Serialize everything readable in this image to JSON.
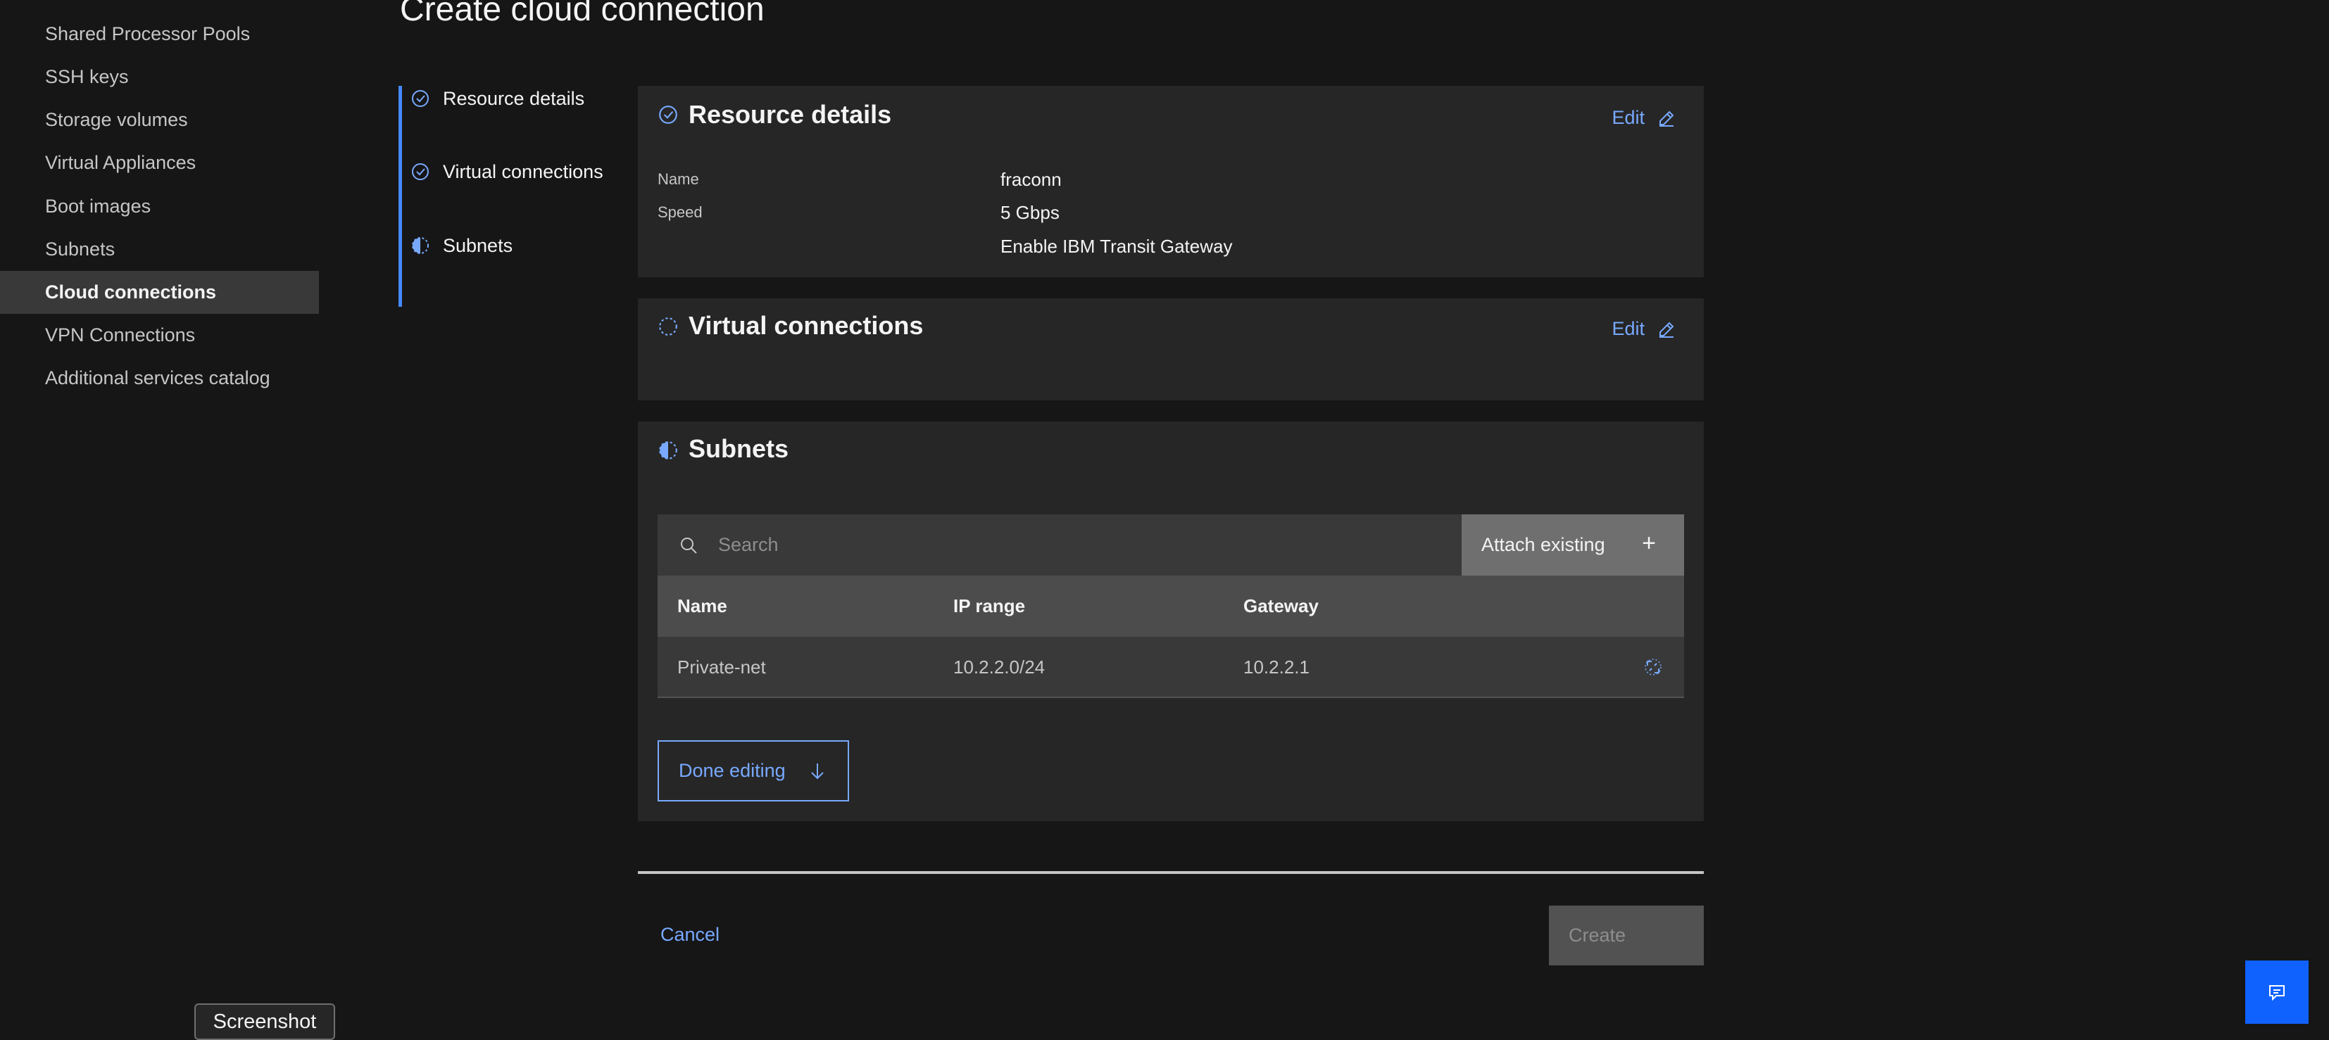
{
  "sidebar": {
    "items": [
      {
        "label": "Shared Processor Pools",
        "active": false
      },
      {
        "label": "SSH keys",
        "active": false
      },
      {
        "label": "Storage volumes",
        "active": false
      },
      {
        "label": "Virtual Appliances",
        "active": false
      },
      {
        "label": "Boot images",
        "active": false
      },
      {
        "label": "Subnets",
        "active": false
      },
      {
        "label": "Cloud connections",
        "active": true
      },
      {
        "label": "VPN Connections",
        "active": false
      },
      {
        "label": "Additional services catalog",
        "active": false
      }
    ]
  },
  "page": {
    "title": "Create cloud connection"
  },
  "progress": {
    "steps": [
      {
        "label": "Resource details",
        "status": "complete",
        "icon": "checkmark-outline-icon"
      },
      {
        "label": "Virtual connections",
        "status": "complete",
        "icon": "checkmark-outline-icon"
      },
      {
        "label": "Subnets",
        "status": "current",
        "icon": "incomplete-icon"
      }
    ]
  },
  "resource_details": {
    "title": "Resource details",
    "edit_label": "Edit",
    "name_label": "Name",
    "name_value": "fraconn",
    "speed_label": "Speed",
    "speed_value": "5 Gbps",
    "transit_value": "Enable IBM Transit Gateway"
  },
  "virtual_connections": {
    "title": "Virtual connections",
    "edit_label": "Edit"
  },
  "subnets": {
    "title": "Subnets",
    "search_placeholder": "Search",
    "attach_label": "Attach existing",
    "attach_icon": "+",
    "columns": [
      "Name",
      "IP range",
      "Gateway"
    ],
    "rows": [
      {
        "name": "Private-net",
        "ip_range": "10.2.2.0/24",
        "gateway": "10.2.2.1"
      }
    ],
    "done_label": "Done editing"
  },
  "footer": {
    "cancel_label": "Cancel",
    "create_label": "Create"
  },
  "tooltip": {
    "label": "Screenshot"
  },
  "colors": {
    "background": "#161616",
    "panel": "#262626",
    "accent": "#78a9ff",
    "primary": "#0f62fe"
  }
}
